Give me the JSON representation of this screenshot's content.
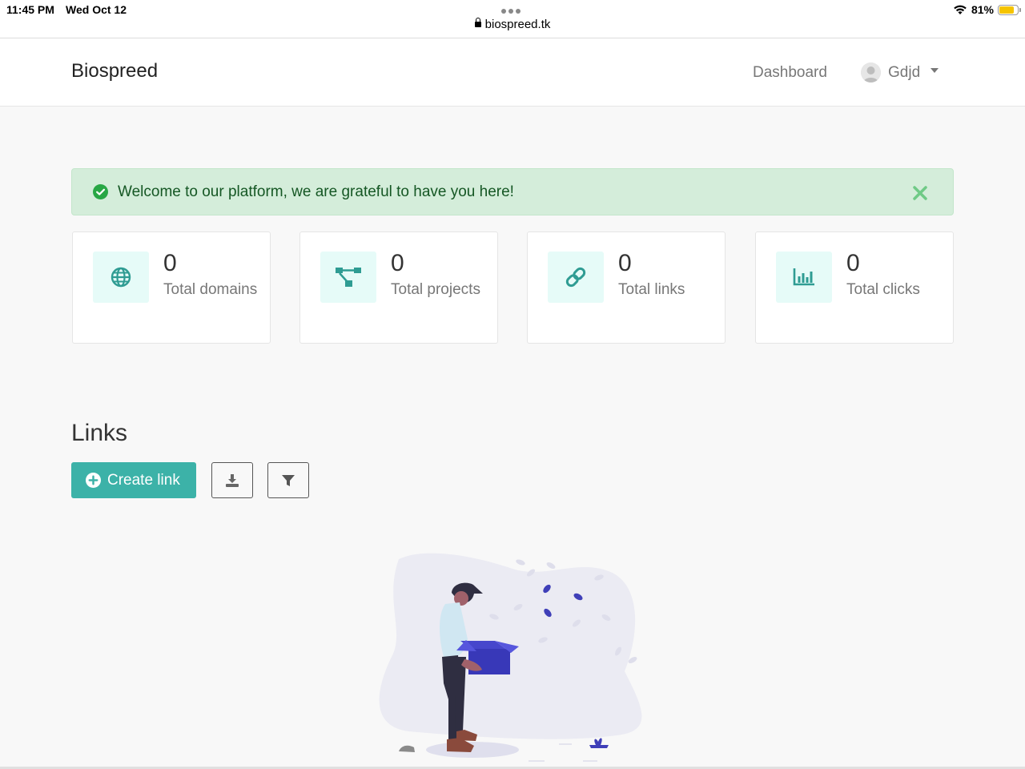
{
  "status_bar": {
    "time": "11:45 PM",
    "date": "Wed Oct 12",
    "url": "biospreed.tk",
    "battery": "81%",
    "battery_level": 0.81
  },
  "navbar": {
    "brand": "Biospreed",
    "dashboard_label": "Dashboard",
    "user_name": "Gdjd"
  },
  "alert": {
    "message": "Welcome to our platform, we are grateful to have you here!"
  },
  "stats": [
    {
      "value": "0",
      "label": "Total domains",
      "icon": "globe-icon"
    },
    {
      "value": "0",
      "label": "Total projects",
      "icon": "project-diagram-icon"
    },
    {
      "value": "0",
      "label": "Total links",
      "icon": "link-icon"
    },
    {
      "value": "0",
      "label": "Total clicks",
      "icon": "chart-bar-icon"
    }
  ],
  "links": {
    "title": "Links",
    "create_label": "Create link"
  },
  "colors": {
    "accent": "#3cb2a8",
    "alert_bg": "#d4edda",
    "alert_text": "#155724",
    "icon_bg": "#e6fbf8"
  }
}
